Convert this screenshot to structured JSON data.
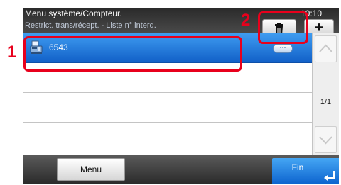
{
  "header": {
    "title": "Menu système/Compteur.",
    "subtitle": "Restrict. trans/récept. - Liste n° interd.",
    "clock": "10:10",
    "add_label": "+"
  },
  "list": {
    "items": [
      {
        "label": "6543",
        "icon": "fax-icon",
        "selected": true,
        "detail_label": "···"
      },
      {
        "label": ""
      },
      {
        "label": ""
      },
      {
        "label": ""
      }
    ]
  },
  "scrollbar": {
    "page_indicator": "1/1"
  },
  "footer": {
    "menu_label": "Menu",
    "fin_label": "Fin"
  },
  "annotations": {
    "callout_1": "1",
    "callout_2": "2"
  },
  "colors": {
    "callout": "#e8001c",
    "selection": "#1d78dc",
    "header": "#333333"
  }
}
